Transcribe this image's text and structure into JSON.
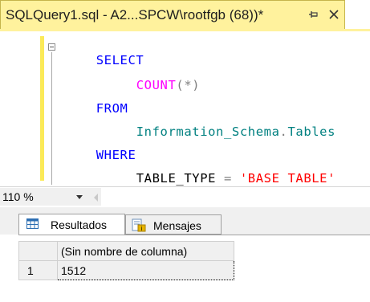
{
  "document_tab": {
    "title": "SQLQuery1.sql - A2...SPCW\\rootfgb (68))*",
    "pin_icon": "pin-icon",
    "close_icon": "close-icon",
    "accent_color": "#fff29d"
  },
  "editor": {
    "lines": [
      {
        "tokens": [
          {
            "t": "SELECT",
            "c": "kw"
          }
        ]
      },
      {
        "tokens": [
          {
            "t": "COUNT",
            "c": "fn"
          },
          {
            "t": "(",
            "c": "op"
          },
          {
            "t": "*",
            "c": "op"
          },
          {
            "t": ")",
            "c": "op"
          }
        ]
      },
      {
        "tokens": [
          {
            "t": "FROM",
            "c": "kw"
          }
        ]
      },
      {
        "tokens": [
          {
            "t": "Information_Schema",
            "c": "obj"
          },
          {
            "t": ".",
            "c": "op"
          },
          {
            "t": "Tables",
            "c": "obj"
          }
        ]
      },
      {
        "tokens": [
          {
            "t": "WHERE",
            "c": "kw"
          }
        ]
      },
      {
        "tokens": [
          {
            "t": "TABLE_TYPE",
            "c": "plain"
          },
          {
            "t": " = ",
            "c": "op"
          },
          {
            "t": "'BASE TABLE'",
            "c": "str"
          }
        ]
      }
    ],
    "colors": {
      "keyword": "#0000ff",
      "function": "#ff00ff",
      "operator": "#808080",
      "string": "#ff0000",
      "object": "#008080"
    }
  },
  "zoom": {
    "value": "110 %"
  },
  "results": {
    "tabs": [
      {
        "label": "Resultados",
        "icon": "grid-icon",
        "active": true
      },
      {
        "label": "Mensajes",
        "icon": "messages-icon",
        "active": false
      }
    ],
    "grid": {
      "columns": [
        "(Sin nombre de columna)"
      ],
      "rows": [
        {
          "row_number": "1",
          "values": [
            "1512"
          ]
        }
      ]
    }
  }
}
